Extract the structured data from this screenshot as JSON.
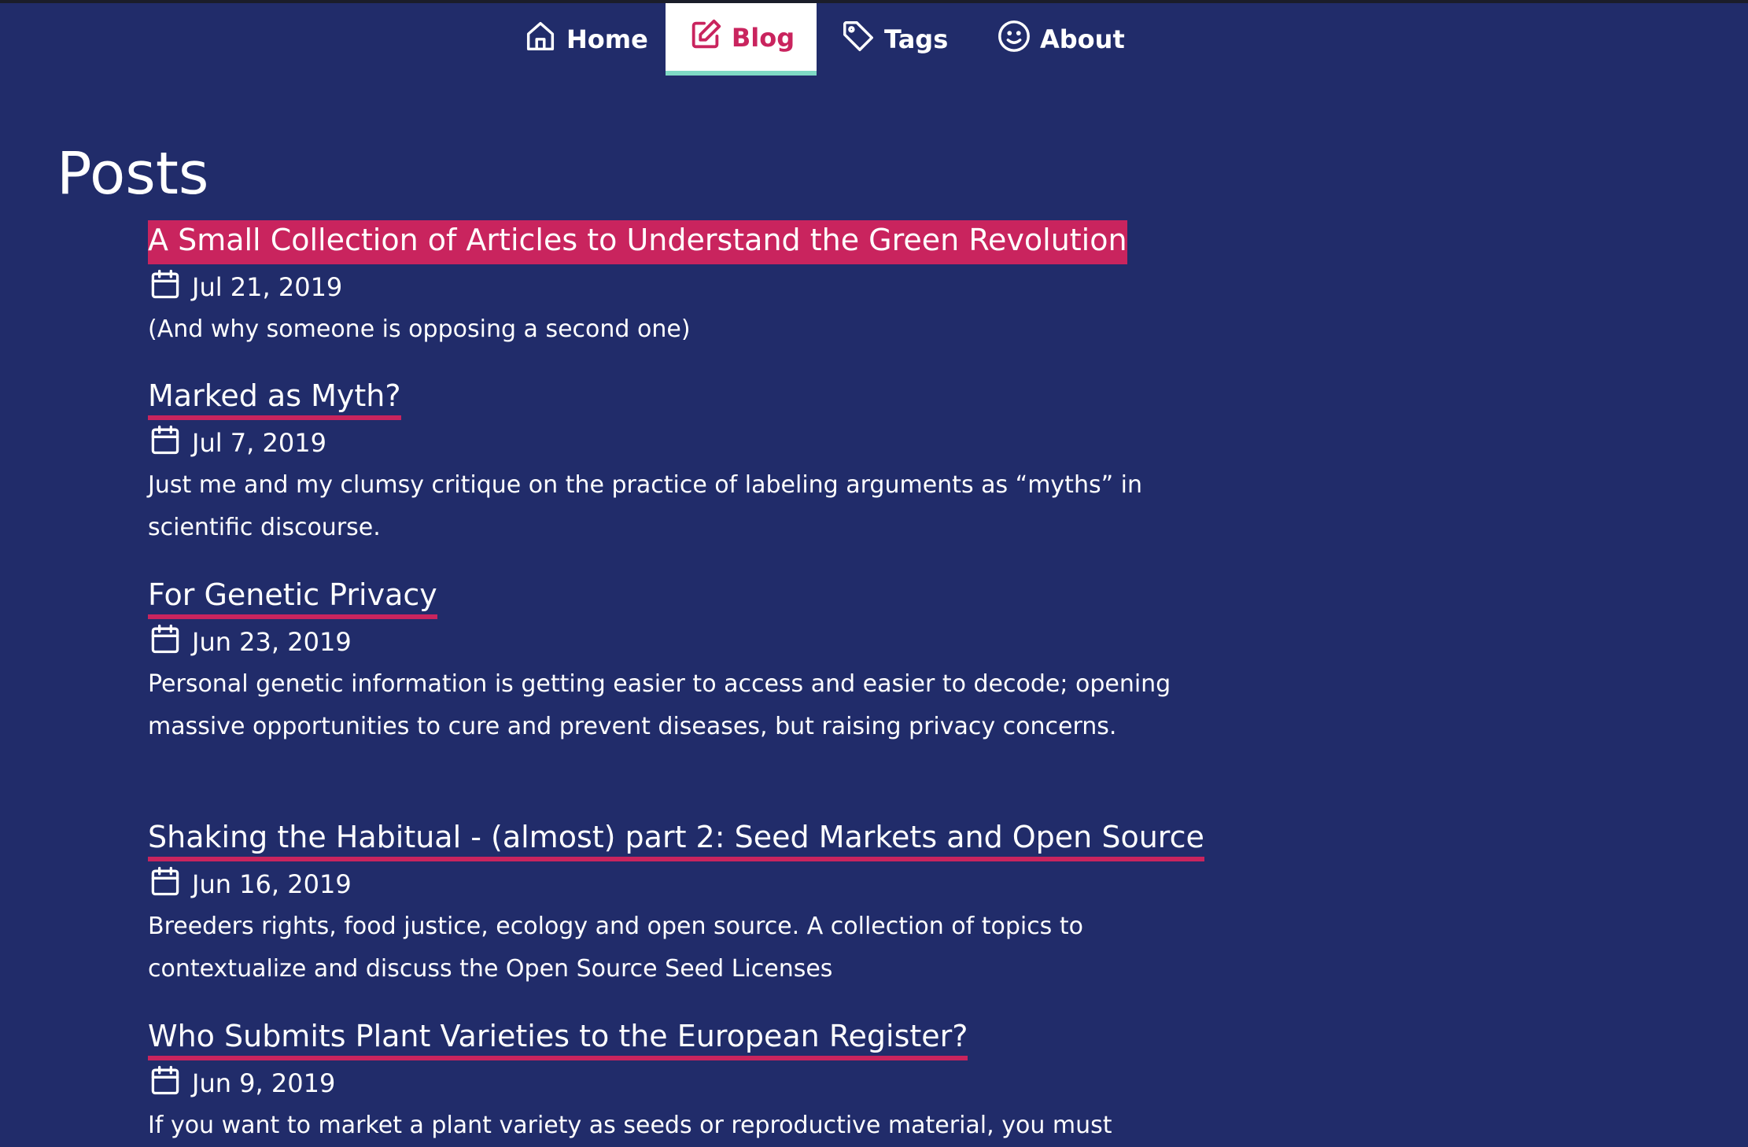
{
  "nav": {
    "items": [
      {
        "label": "Home",
        "icon": "home-icon"
      },
      {
        "label": "Blog",
        "icon": "edit-icon",
        "active": true
      },
      {
        "label": "Tags",
        "icon": "tag-icon"
      },
      {
        "label": "About",
        "icon": "smile-icon"
      }
    ]
  },
  "page": {
    "title": "Posts"
  },
  "posts": [
    {
      "title": "A Small Collection of Articles to Understand the Green Revolution",
      "date": "Jul 21, 2019",
      "summary": "(And why someone is opposing a second one)"
    },
    {
      "title": "Marked as Myth?",
      "date": "Jul 7, 2019",
      "summary": "Just me and my clumsy critique on the practice of labeling arguments as “myths” in scientific discourse."
    },
    {
      "title": "For Genetic Privacy",
      "date": "Jun 23, 2019",
      "summary": "Personal genetic information is getting easier to access and easier to decode; opening massive opportunities to cure and prevent diseases, but raising privacy concerns."
    },
    {
      "title": "Shaking the Habitual - (almost) part 2: Seed Markets and Open Source",
      "date": "Jun 16, 2019",
      "summary": "Breeders rights, food justice, ecology and open source. A collection of topics to contextualize and discuss the Open Source Seed Licenses"
    },
    {
      "title": "Who Submits Plant Varieties to the European Register?",
      "date": "Jun 9, 2019",
      "summary": "If you want to market a plant variety as seeds or reproductive material, you must"
    }
  ],
  "colors": {
    "background": "#212c6a",
    "accent": "#c9245e",
    "nav_active_underline": "#7fd9c5",
    "text": "#ffffff"
  }
}
